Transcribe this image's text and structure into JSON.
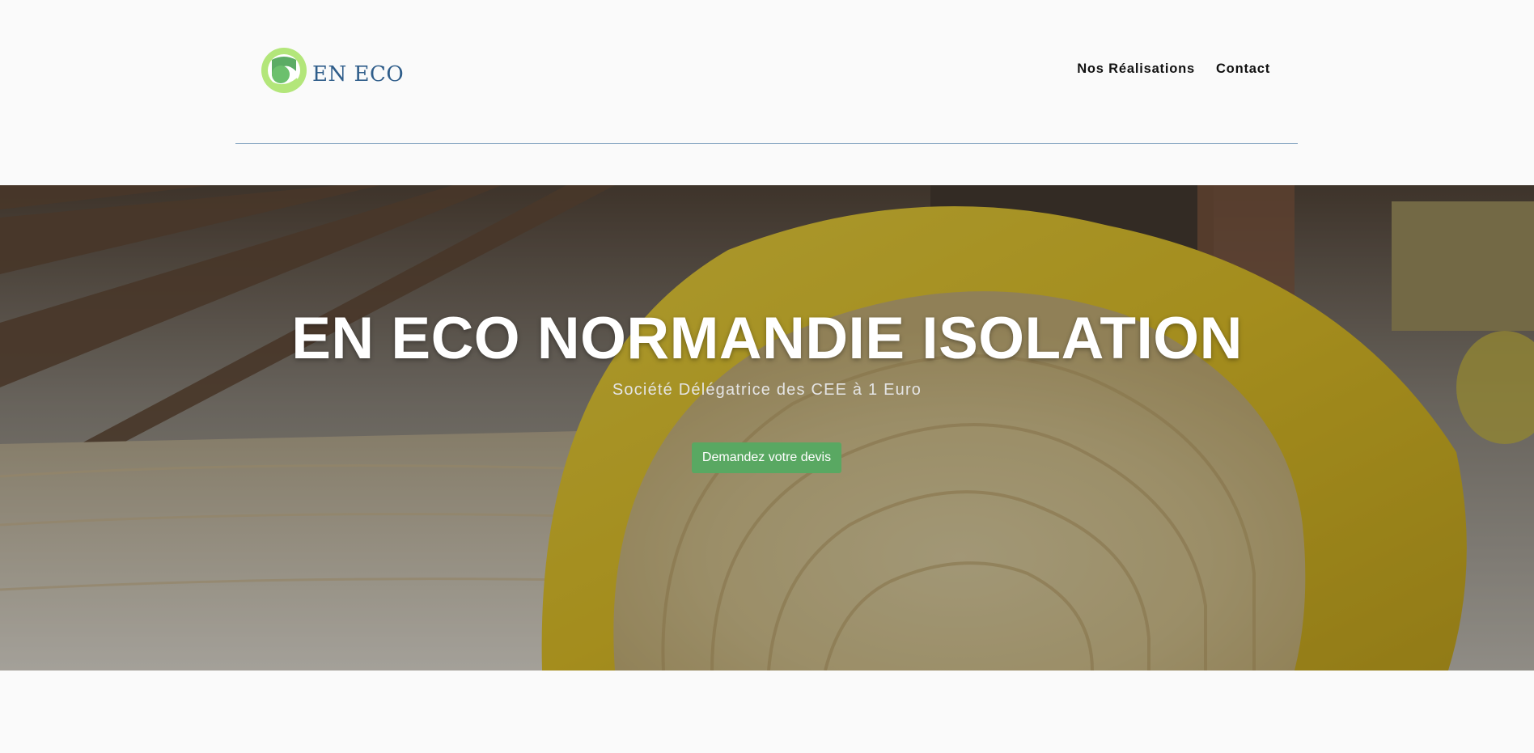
{
  "brand": {
    "logo_text": "EN ECO",
    "logo_icon": "leaf-circle-logo",
    "primary_color": "#2f5d8a",
    "logo_green_light": "#b3e67a",
    "logo_green_dark": "#3f9e4a"
  },
  "nav": {
    "items": [
      {
        "label": "Nos Réalisations"
      },
      {
        "label": "Contact"
      }
    ]
  },
  "hero": {
    "title": "EN ECO NORMANDIE ISOLATION",
    "subtitle": "Société Délégatrice des CEE à 1 Euro",
    "cta_label": "Demandez votre devis",
    "cta_color": "#59a862",
    "background": "attic-insulation-roll-photo"
  }
}
